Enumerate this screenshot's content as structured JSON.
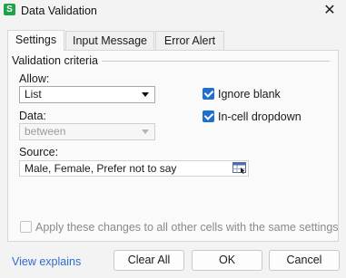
{
  "window": {
    "title": "Data Validation",
    "app_icon_letter": "S",
    "close_glyph": "✕"
  },
  "tabs": [
    {
      "label": "Settings",
      "active": true
    },
    {
      "label": "Input Message",
      "active": false
    },
    {
      "label": "Error Alert",
      "active": false
    }
  ],
  "criteria": {
    "group_label": "Validation criteria",
    "allow_label": "Allow:",
    "allow_value": "List",
    "data_label": "Data:",
    "data_value": "between",
    "source_label": "Source:",
    "source_value": "Male, Female, Prefer not to say",
    "ignore_blank_label": "Ignore blank",
    "ignore_blank_checked": true,
    "dropdown_label": "In-cell dropdown",
    "dropdown_checked": true
  },
  "apply_all": {
    "label": "Apply these changes to all other cells with the same settings",
    "checked": false,
    "enabled": false
  },
  "footer": {
    "help_link": "View explains",
    "clear_all": "Clear All",
    "ok": "OK",
    "cancel": "Cancel"
  },
  "colors": {
    "accent": "#1f6fd1",
    "link": "#2f6cd0",
    "app_icon": "#1fa34a"
  },
  "icons": {
    "app": "spreadsheet-app-icon",
    "close": "close-icon",
    "range_picker": "range-select-icon",
    "dropdown": "chevron-down-icon"
  }
}
